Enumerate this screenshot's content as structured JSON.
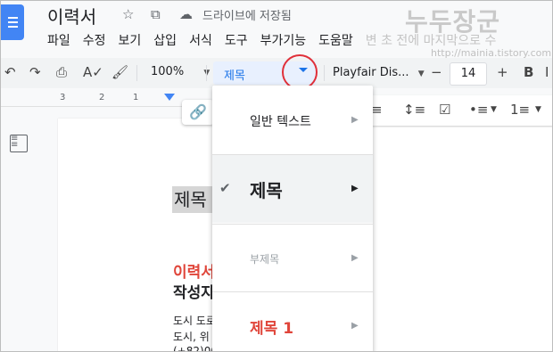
{
  "header": {
    "doc_title": "이력서",
    "save_status": "드라이브에 저장됨"
  },
  "watermark": {
    "title": "누두장군",
    "url": "http://mainia.tistory.com"
  },
  "menu": {
    "items": [
      "파일",
      "수정",
      "보기",
      "삽입",
      "서식",
      "도구",
      "부가기능",
      "도움말"
    ],
    "faded_text": "변 초 전에 마지막으로 수"
  },
  "toolbar": {
    "zoom": "100%",
    "style": "제목",
    "font_family": "Playfair Dis...",
    "font_size": "14",
    "bold_label": "B"
  },
  "ruler": {
    "ticks": [
      "3",
      "2",
      "1"
    ]
  },
  "document": {
    "selected_heading": "제목",
    "red_heading": "이력서",
    "bold_line": "작성자",
    "lines": [
      "도시 도로",
      "도시, 위",
      "(+82)00"
    ]
  },
  "dropdown": {
    "items": [
      {
        "label": "일반 텍스트",
        "checked": false
      },
      {
        "label": "제목",
        "checked": true
      },
      {
        "label": "부제목",
        "checked": false
      },
      {
        "label": "제목 1",
        "checked": false
      }
    ]
  },
  "colors": {
    "accent": "#1a73e8",
    "highlight_ring": "#e0303a",
    "red_text": "#e0453a"
  }
}
